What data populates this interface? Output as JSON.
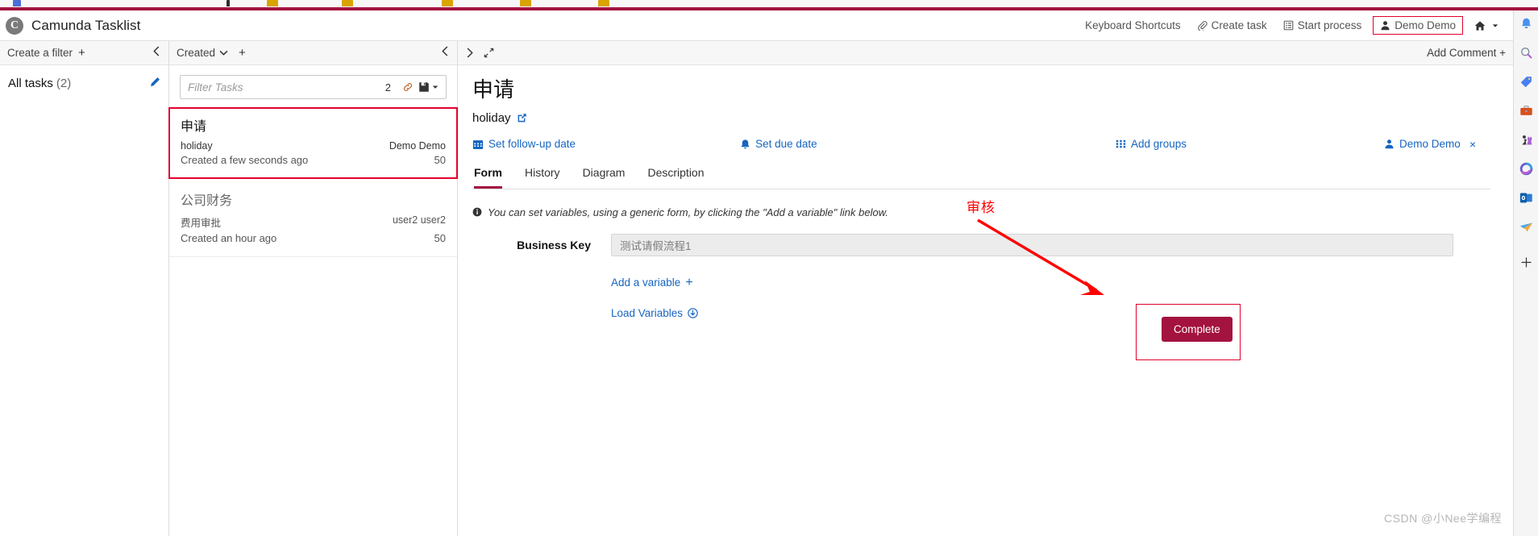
{
  "browser": {
    "bookmark_count": 6
  },
  "header": {
    "logo_letter": "C",
    "title": "Camunda Tasklist",
    "actions": [
      {
        "label": "Keyboard Shortcuts",
        "icon": "none",
        "highlighted": false
      },
      {
        "label": "Create task",
        "icon": "paperclip-icon",
        "highlighted": false
      },
      {
        "label": "Start process",
        "icon": "list-icon",
        "highlighted": false
      },
      {
        "label": "Demo Demo",
        "icon": "user-icon",
        "highlighted": true
      },
      {
        "label": "",
        "icon": "home-caret-icon",
        "highlighted": false
      }
    ],
    "highlight_color": "#e3002b",
    "brand_color": "#a4123f"
  },
  "edge_sidebar": {
    "icons": [
      "bell-icon",
      "search-icon",
      "tag-icon",
      "briefcase-icon",
      "games-icon",
      "microsoft-365-icon",
      "outlook-icon",
      "send-icon",
      "add-icon"
    ]
  },
  "filter_pane": {
    "header_label": "Create a filter",
    "header_plus": "+",
    "collapse_icon": "chevron-left-icon",
    "filters": [
      {
        "name": "All tasks",
        "count": "(2)",
        "edit_icon": "pencil-icon"
      }
    ]
  },
  "task_list": {
    "header_label": "Created",
    "header_caret": "chevron-down-icon",
    "header_plus": "+",
    "collapse_icon": "chevron-left-icon",
    "search": {
      "placeholder": "Filter Tasks",
      "value": "",
      "result_count": "2",
      "link_icon": "link-icon",
      "save_icon": "save-icon"
    },
    "tasks": [
      {
        "title": "申请",
        "process": "holiday",
        "assignee": "Demo Demo",
        "created": "Created a few seconds ago",
        "priority": "50",
        "selected": true
      },
      {
        "title": "公司财务",
        "process": "费用审批",
        "assignee": "user2 user2",
        "created": "Created an hour ago",
        "priority": "50",
        "selected": false
      }
    ]
  },
  "detail": {
    "expand_icon": "chevron-right-icon",
    "fullscreen_icon": "expand-icon",
    "add_comment_label": "Add Comment +",
    "title": "申请",
    "process_name": "holiday",
    "process_link_icon": "external-link-icon",
    "meta": {
      "follow_up_label": "Set follow-up date",
      "follow_up_icon": "calendar-icon",
      "due_label": "Set due date",
      "due_icon": "bell-icon",
      "groups_label": "Add groups",
      "groups_icon": "grid-icon",
      "assignee_label": "Demo Demo",
      "assignee_icon": "user-icon",
      "assignee_remove": "×"
    },
    "tabs": [
      {
        "label": "Form",
        "active": true
      },
      {
        "label": "History",
        "active": false
      },
      {
        "label": "Diagram",
        "active": false
      },
      {
        "label": "Description",
        "active": false
      }
    ],
    "form": {
      "note_icon": "info-icon",
      "note": "You can set variables, using a generic form, by clicking the \"Add a variable\" link below.",
      "fields": [
        {
          "label": "Business Key",
          "value": "测试请假流程1"
        }
      ],
      "add_variable_label": "Add a variable",
      "add_variable_icon": "+",
      "load_variables_label": "Load Variables",
      "load_variables_icon": "download-circle-icon"
    },
    "complete_button_label": "Complete"
  },
  "annotations": {
    "note_text": "审核",
    "note_color": "#ff0000",
    "arrow_color": "#ff0000",
    "box_color": "#e3002b"
  },
  "watermark": "CSDN @小Nee学编程"
}
